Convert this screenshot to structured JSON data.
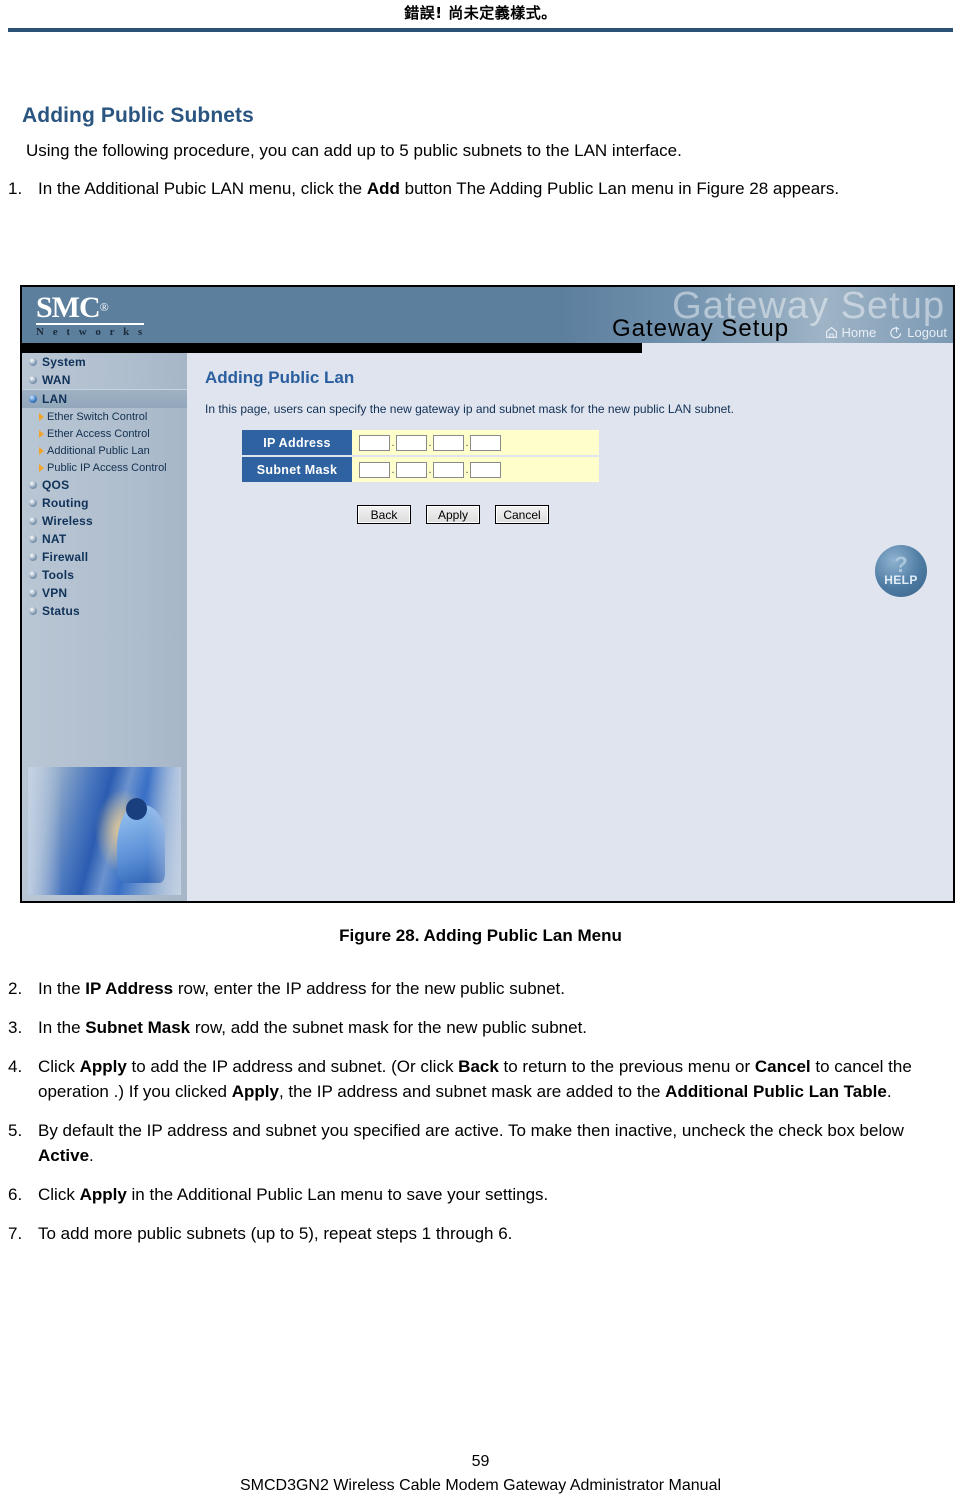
{
  "page": {
    "running_header": "錯誤! 尚未定義樣式。",
    "page_number": "59",
    "footer_title": "SMCD3GN2 Wireless Cable Modem Gateway Administrator Manual"
  },
  "section": {
    "title": "Adding Public Subnets",
    "intro": "Using the following procedure, you can add up to 5 public subnets to the LAN interface."
  },
  "steps_before": [
    {
      "num": "1.",
      "html": "In the Additional Pubic LAN menu, click the <b>Add</b> button The Adding Public Lan menu in Figure 28 appears."
    }
  ],
  "figure": {
    "caption": "Figure 28. Adding Public Lan Menu"
  },
  "steps_after": [
    {
      "num": "2.",
      "html": "In the <b>IP Address</b> row, enter the IP address for the new public subnet."
    },
    {
      "num": "3.",
      "html": "In the <b>Subnet Mask</b> row, add the subnet mask for the new public subnet."
    },
    {
      "num": "4.",
      "html": "Click <b>Apply</b> to add the IP address and subnet. (Or click <b>Back</b> to return to the previous menu or <b>Cancel</b> to cancel the operation .) If you clicked <b>Apply</b>, the IP address and subnet mask are added to the <b>Additional Public Lan Table</b>."
    },
    {
      "num": "5.",
      "html": "By default the IP address and subnet you specified are active. To make then inactive, uncheck the check box below <b>Active</b>."
    },
    {
      "num": "6.",
      "html": "Click <b>Apply</b> in the Additional Public Lan menu to save your settings."
    },
    {
      "num": "7.",
      "html": "To add more public subnets (up to 5), repeat steps 1 through 6."
    }
  ],
  "router_ui": {
    "brand": {
      "name": "SMC",
      "registered": "®",
      "tagline": "N e t w o r k s"
    },
    "header": {
      "ghost_title": "Gateway Setup",
      "title": "Gateway Setup",
      "nav": [
        {
          "label": "Home",
          "icon": "home-icon"
        },
        {
          "label": "Logout",
          "icon": "logout-icon"
        }
      ]
    },
    "sidebar": {
      "items": [
        {
          "label": "System",
          "active": false,
          "type": "top"
        },
        {
          "label": "WAN",
          "active": false,
          "type": "top"
        },
        {
          "label": "LAN",
          "active": true,
          "type": "top"
        },
        {
          "label": "Ether Switch Control",
          "type": "sub"
        },
        {
          "label": "Ether Access Control",
          "type": "sub"
        },
        {
          "label": "Additional Public Lan",
          "type": "sub"
        },
        {
          "label": "Public IP Access Control",
          "type": "sub"
        },
        {
          "label": "QOS",
          "active": false,
          "type": "top"
        },
        {
          "label": "Routing",
          "active": false,
          "type": "top"
        },
        {
          "label": "Wireless",
          "active": false,
          "type": "top"
        },
        {
          "label": "NAT",
          "active": false,
          "type": "top"
        },
        {
          "label": "Firewall",
          "active": false,
          "type": "top"
        },
        {
          "label": "Tools",
          "active": false,
          "type": "top"
        },
        {
          "label": "VPN",
          "active": false,
          "type": "top"
        },
        {
          "label": "Status",
          "active": false,
          "type": "top"
        }
      ]
    },
    "panel": {
      "title": "Adding Public Lan",
      "description": "In this page, users can specify the new gateway ip and subnet mask for the new public LAN subnet.",
      "rows": [
        {
          "label": "IP Address",
          "octets": [
            "",
            "",
            "",
            ""
          ]
        },
        {
          "label": "Subnet Mask",
          "octets": [
            "",
            "",
            "",
            ""
          ]
        }
      ],
      "buttons": [
        {
          "label": "Back"
        },
        {
          "label": "Apply"
        },
        {
          "label": "Cancel"
        }
      ],
      "help": {
        "glyph": "?",
        "label": "HELP"
      }
    },
    "colors": {
      "header_band": "#5d7f9e",
      "sidebar": "#aebdcd",
      "panel_bg": "#dfe4ee",
      "label_blue": "#2f62a0",
      "field_yellow": "#ffffcc",
      "title_blue": "#2a5e9e"
    }
  }
}
